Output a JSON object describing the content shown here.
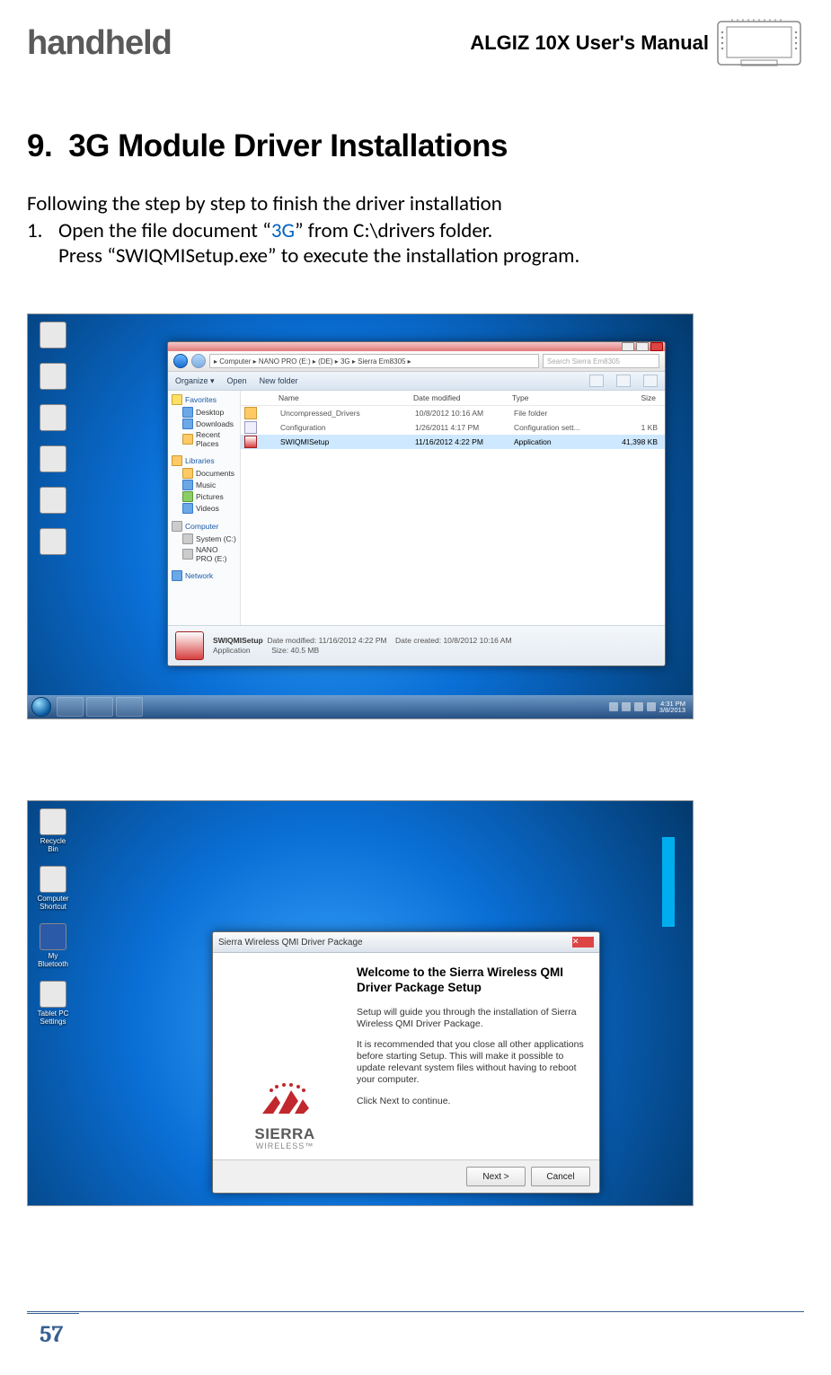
{
  "header": {
    "brand": "handheld",
    "manual_title": "ALGIZ 10X User's Manual"
  },
  "section": {
    "number": "9.",
    "title": "3G Module Driver Installations"
  },
  "intro": "Following the step by step to finish the driver installation",
  "step1": {
    "num": "1.",
    "line_a_pre": "Open the file document “",
    "line_a_link": "3G",
    "line_a_post": "” from C:\\drivers folder.",
    "line_b": "Press “SWIQMISetup.exe” to execute the installation program."
  },
  "explorer": {
    "breadcrumb": "▸ Computer ▸ NANO PRO (E:) ▸ (DE) ▸ 3G ▸ Sierra Em8305 ▸",
    "search_placeholder": "Search Sierra Em8305",
    "toolbar": {
      "organize": "Organize ▾",
      "open": "Open",
      "newfolder": "New folder"
    },
    "nav": {
      "favorites": {
        "head": "Favorites",
        "items": [
          "Desktop",
          "Downloads",
          "Recent Places"
        ]
      },
      "libraries": {
        "head": "Libraries",
        "items": [
          "Documents",
          "Music",
          "Pictures",
          "Videos"
        ]
      },
      "computer": {
        "head": "Computer",
        "items": [
          "System (C:)",
          "NANO PRO (E:)"
        ]
      },
      "network": {
        "head": "Network"
      }
    },
    "columns": {
      "name": "Name",
      "date": "Date modified",
      "type": "Type",
      "size": "Size"
    },
    "rows": [
      {
        "name": "Uncompressed_Drivers",
        "date": "10/8/2012 10:16 AM",
        "type": "File folder",
        "size": ""
      },
      {
        "name": "Configuration",
        "date": "1/26/2011 4:17 PM",
        "type": "Configuration sett...",
        "size": "1 KB"
      },
      {
        "name": "SWIQMISetup",
        "date": "11/16/2012 4:22 PM",
        "type": "Application",
        "size": "41,398 KB"
      }
    ],
    "details": {
      "name": "SWIQMISetup",
      "modified_label": "Date modified:",
      "modified": "11/16/2012 4:22 PM",
      "app_label": "Application",
      "size_label": "Size:",
      "size": "40.5 MB",
      "created_label": "Date created:",
      "created": "10/8/2012 10:16 AM"
    },
    "tray": {
      "time": "4:31 PM",
      "date": "3/8/2013"
    }
  },
  "desktop_icons_1": [
    "",
    "",
    "",
    "",
    "",
    ""
  ],
  "desktop_icons_2": [
    "Recycle Bin",
    "Computer Shortcut",
    "My Bluetooth",
    "Tablet PC Settings"
  ],
  "installer": {
    "title": "Sierra Wireless QMI Driver Package",
    "heading": "Welcome to the Sierra Wireless QMI Driver Package Setup",
    "p1": "Setup will guide you through the installation of Sierra Wireless QMI Driver Package.",
    "p2": "It is recommended that you close all other applications before starting Setup. This will make it possible to update relevant system files without having to reboot your computer.",
    "p3": "Click Next to continue.",
    "brand": "SIERRA",
    "brand_sub": "WIRELESS™",
    "next": "Next >",
    "cancel": "Cancel",
    "close": "✕"
  },
  "page_number": "57"
}
